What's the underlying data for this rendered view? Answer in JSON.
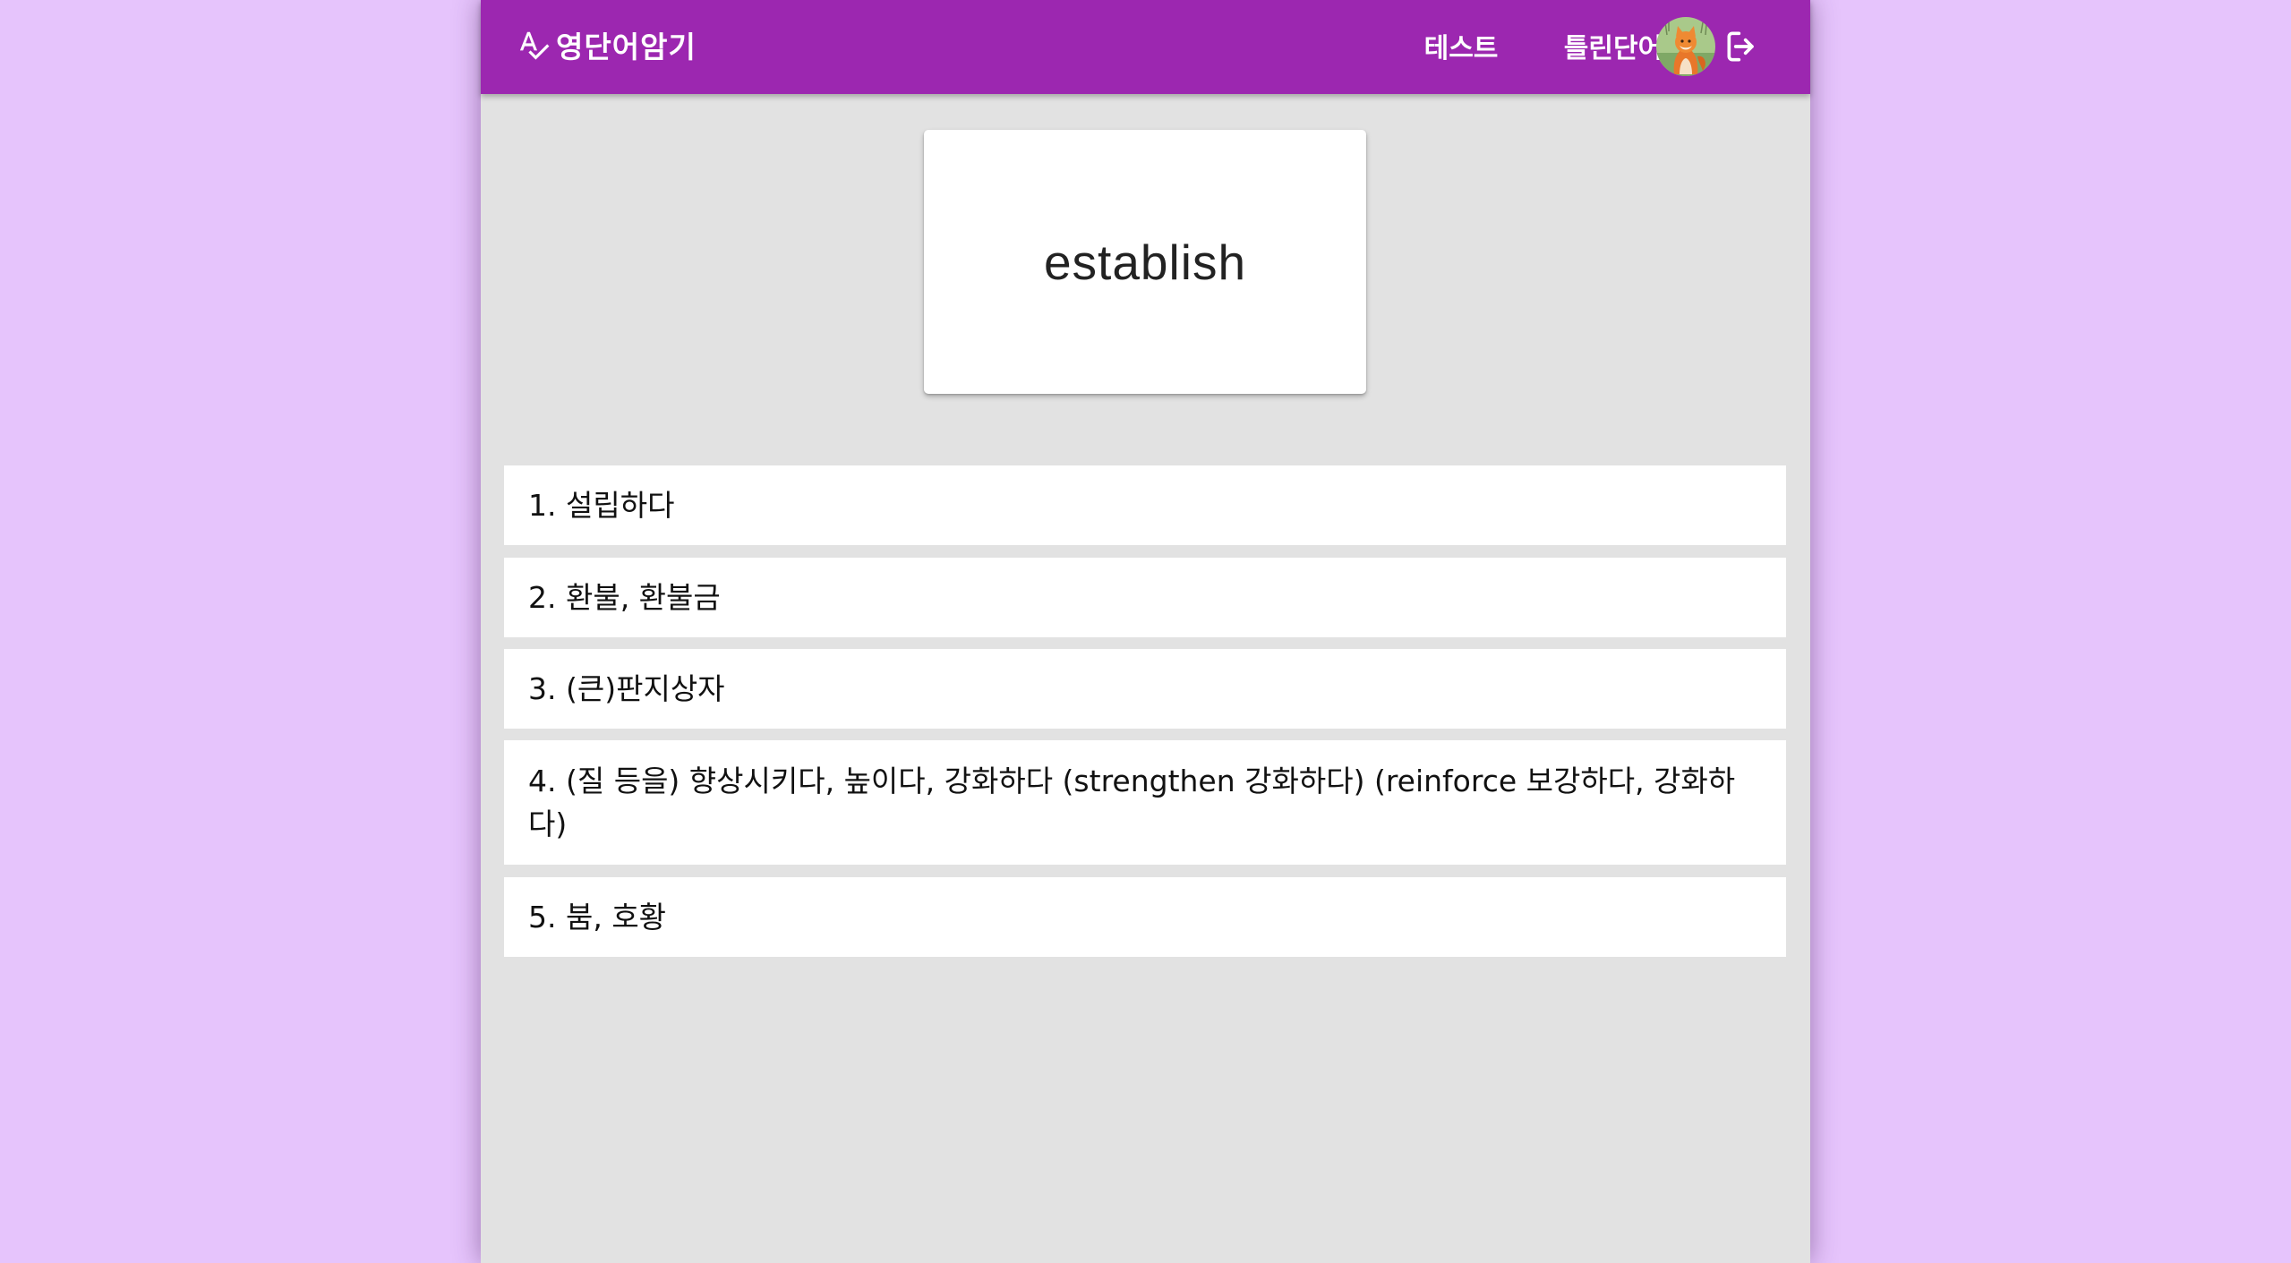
{
  "header": {
    "brand_title": "영단어암기",
    "brand_icon": "spellcheck-icon",
    "nav": {
      "test_label": "테스트",
      "wrong_words_label": "틀린단어"
    },
    "avatar_icon": "user-avatar",
    "logout_icon": "logout-icon"
  },
  "word_card": {
    "word": "establish"
  },
  "choices": [
    {
      "num": "1. ",
      "text": "설립하다"
    },
    {
      "num": "2. ",
      "text": "환불, 환불금"
    },
    {
      "num": "3. ",
      "text": "(큰)판지상자"
    },
    {
      "num": "4. ",
      "text": "(질 등을) 향상시키다, 높이다, 강화하다 (strengthen 강화하다) (reinforce 보강하다, 강화하다)"
    },
    {
      "num": "5. ",
      "text": "붐, 호황"
    }
  ],
  "colors": {
    "page_background": "#e6c4fc",
    "app_bar": "#9c27b0",
    "content_background": "#e2e2e2",
    "card": "#ffffff"
  }
}
